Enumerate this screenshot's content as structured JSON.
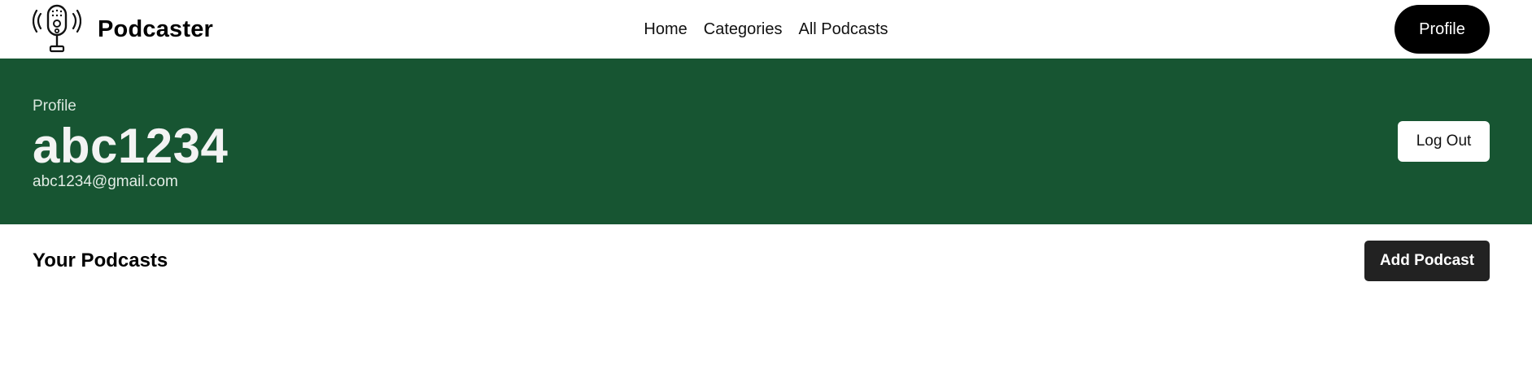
{
  "navbar": {
    "brand_name": "Podcaster",
    "logo_icon": "microphone-icon",
    "links": [
      {
        "label": "Home"
      },
      {
        "label": "Categories"
      },
      {
        "label": "All Podcasts"
      }
    ],
    "profile_label": "Profile"
  },
  "banner": {
    "kicker": "Profile",
    "username": "abc1234",
    "email": "abc1234@gmail.com",
    "logout_label": "Log Out",
    "background_color": "#175532"
  },
  "podcasts_section": {
    "title": "Your Podcasts",
    "add_label": "Add Podcast",
    "items": []
  }
}
